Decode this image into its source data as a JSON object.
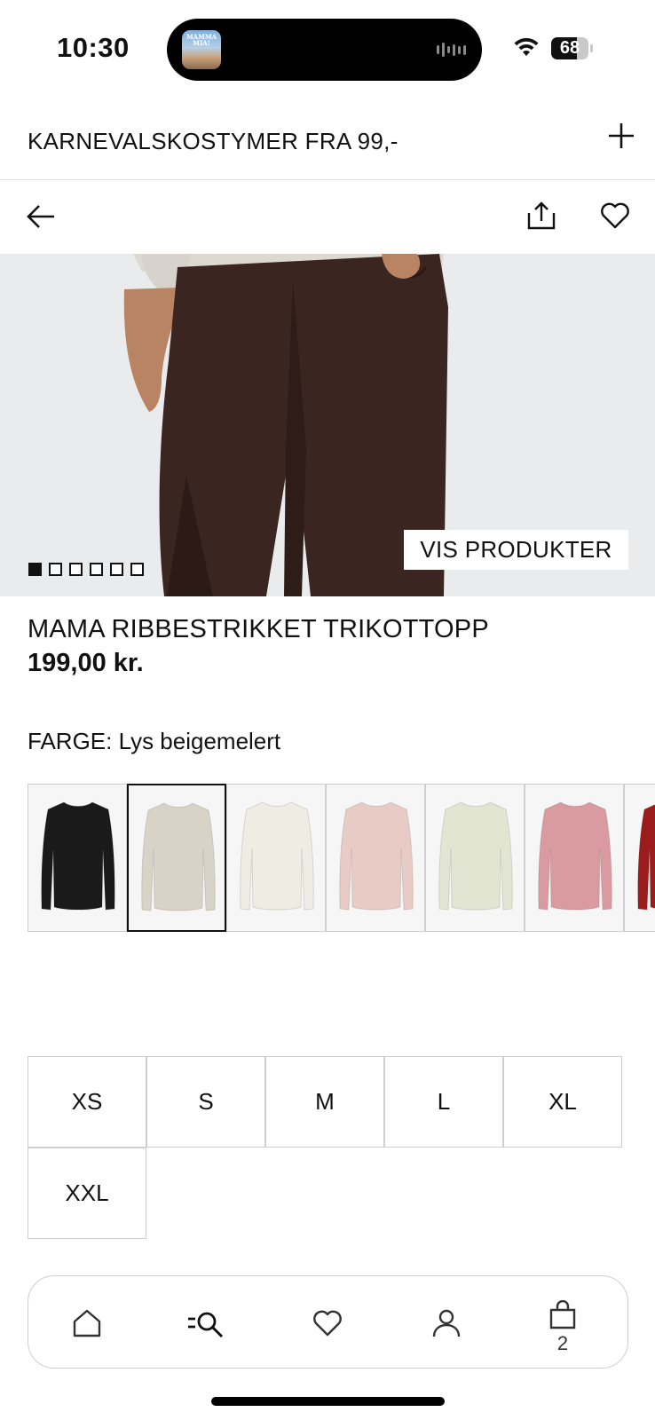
{
  "status_bar": {
    "time": "10:30",
    "battery": "68",
    "now_playing_thumb_text": "MAMMA MIA!"
  },
  "promo": {
    "text": "KARNEVALSKOSTYMER FRA 99,-",
    "expand_icon": "plus-icon"
  },
  "header": {
    "back_icon": "arrow-left-icon",
    "share_icon": "share-icon",
    "favorite_icon": "heart-icon"
  },
  "hero": {
    "button_label": "VIS PRODUKTER",
    "image_count": 6,
    "active_index": 0
  },
  "product": {
    "name": "MAMA RIBBESTRIKKET TRIKOTTOPP",
    "price": "199,00 kr.",
    "color_label": "FARGE: Lys beigemelert"
  },
  "swatches": [
    {
      "color": "#1a1a1a",
      "selected": false
    },
    {
      "color": "#d9d2c6",
      "selected": true
    },
    {
      "color": "#efece3",
      "selected": false
    },
    {
      "color": "#e7cbc4",
      "selected": false
    },
    {
      "color": "#e3e5d3",
      "selected": false
    },
    {
      "color": "#d99aa0",
      "selected": false
    },
    {
      "color": "#9b1c1c",
      "selected": false
    }
  ],
  "sizes": [
    "XS",
    "S",
    "M",
    "L",
    "XL",
    "XXL"
  ],
  "bottom_nav": {
    "items": [
      "home-icon",
      "search-icon",
      "heart-icon",
      "account-icon",
      "bag-icon"
    ],
    "cart_count": "2"
  }
}
